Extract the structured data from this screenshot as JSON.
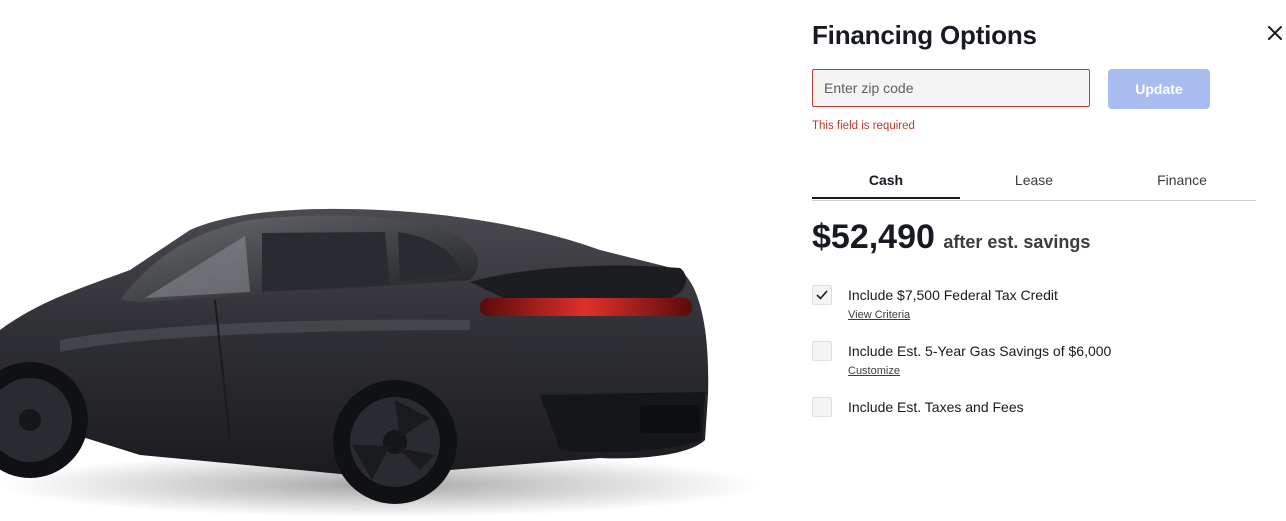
{
  "hero": {
    "image": "black-suv-rear-three-quarter"
  },
  "panel": {
    "title": "Financing Options",
    "close_icon": "close-icon"
  },
  "zip": {
    "placeholder": "Enter zip code",
    "value": "",
    "error": "This field is required",
    "update_label": "Update"
  },
  "tabs": [
    {
      "label": "Cash",
      "active": true
    },
    {
      "label": "Lease",
      "active": false
    },
    {
      "label": "Finance",
      "active": false
    }
  ],
  "price": {
    "amount": "$52,490",
    "suffix": "after est. savings"
  },
  "options": [
    {
      "label": "Include $7,500 Federal Tax Credit",
      "checked": true,
      "link": "View Criteria"
    },
    {
      "label": "Include Est. 5-Year Gas Savings of $6,000",
      "checked": false,
      "link": "Customize"
    },
    {
      "label": "Include Est. Taxes and Fees",
      "checked": false,
      "link": ""
    }
  ],
  "colors": {
    "error": "#c0392b",
    "update_button": "#a9bcf0",
    "text": "#171a20"
  }
}
